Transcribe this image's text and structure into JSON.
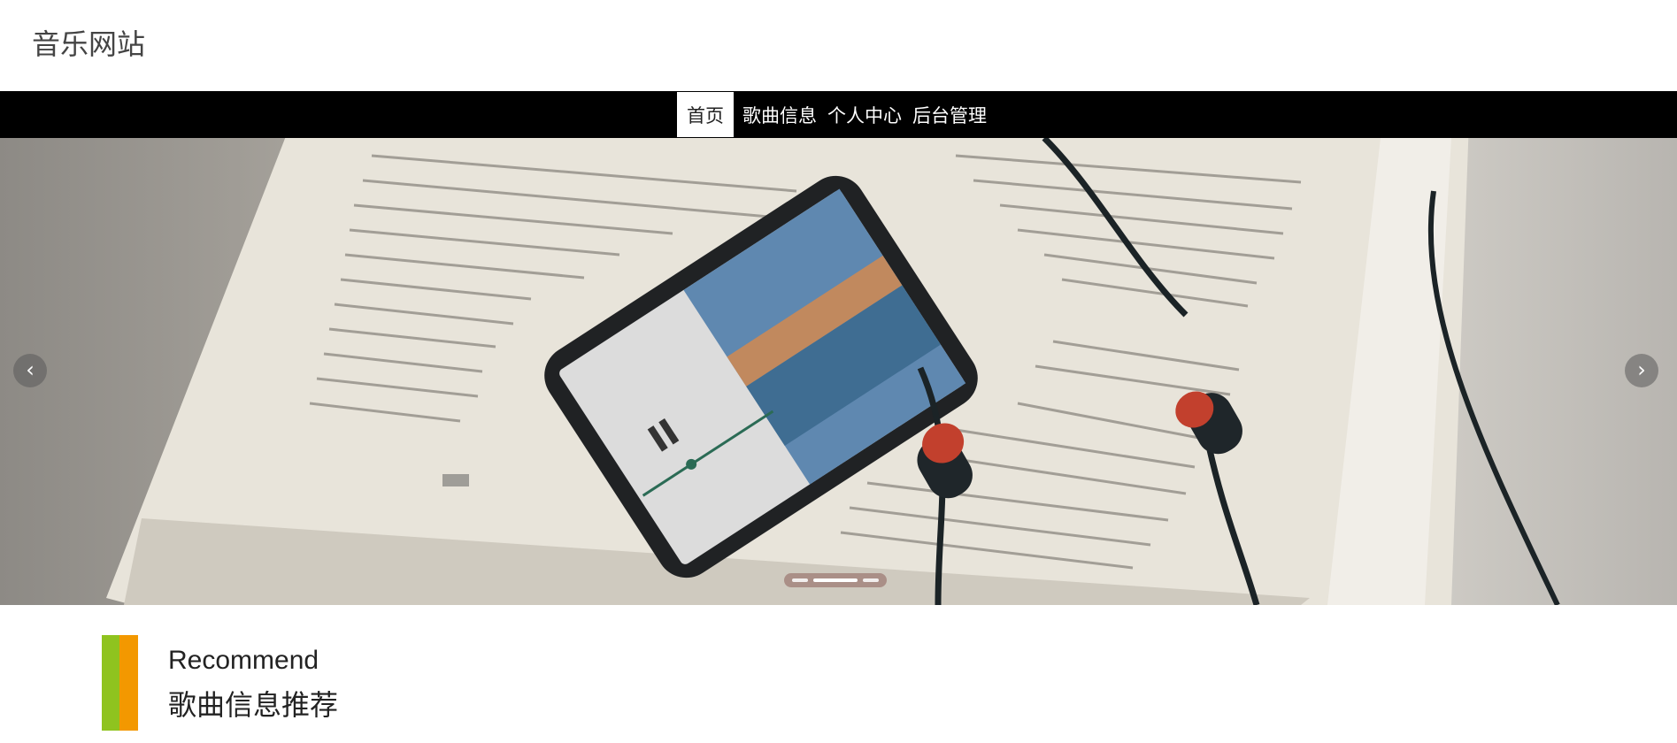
{
  "header": {
    "site_title": "音乐网站"
  },
  "nav": {
    "items": [
      {
        "label": "首页",
        "active": true
      },
      {
        "label": "歌曲信息",
        "active": false
      },
      {
        "label": "个人中心",
        "active": false
      },
      {
        "label": "后台管理",
        "active": false
      }
    ]
  },
  "banner": {
    "prev_icon": "chevron-left-icon",
    "next_icon": "chevron-right-icon",
    "prev_glyph": "‹",
    "next_glyph": "›",
    "slide_count": 3,
    "active_slide": 2
  },
  "recommend": {
    "title_en": "Recommend",
    "title_cn": "歌曲信息推荐",
    "accent_colors": [
      "#8fc31f",
      "#f39800"
    ]
  }
}
